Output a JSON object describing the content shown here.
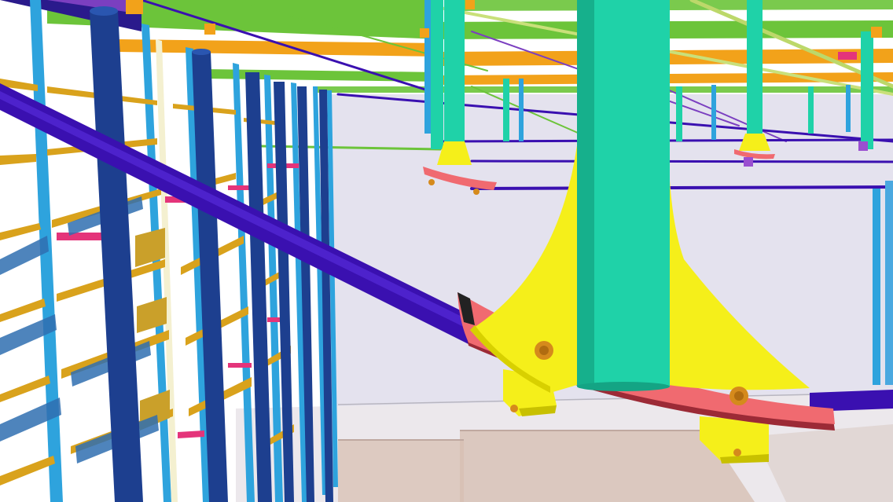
{
  "scene": {
    "colors": {
      "background": "#ffffff",
      "far_wall": "#e4e2ee",
      "floor_panel": "#d9c2b6",
      "column_navy": "#1d3f8f",
      "column_teal": "#1fd2a8",
      "tie_rod_purple": "#3a10b0",
      "gusset_yellow": "#f5ef1a",
      "base_plate_salmon": "#f06a70",
      "beam_green": "#6cc43a",
      "beam_orange": "#f2a21a",
      "girt_gold": "#d9a21c",
      "stud_blue": "#2ea3dd",
      "brace_magenta": "#e4347a",
      "bolt_orange": "#d58a1c"
    }
  }
}
